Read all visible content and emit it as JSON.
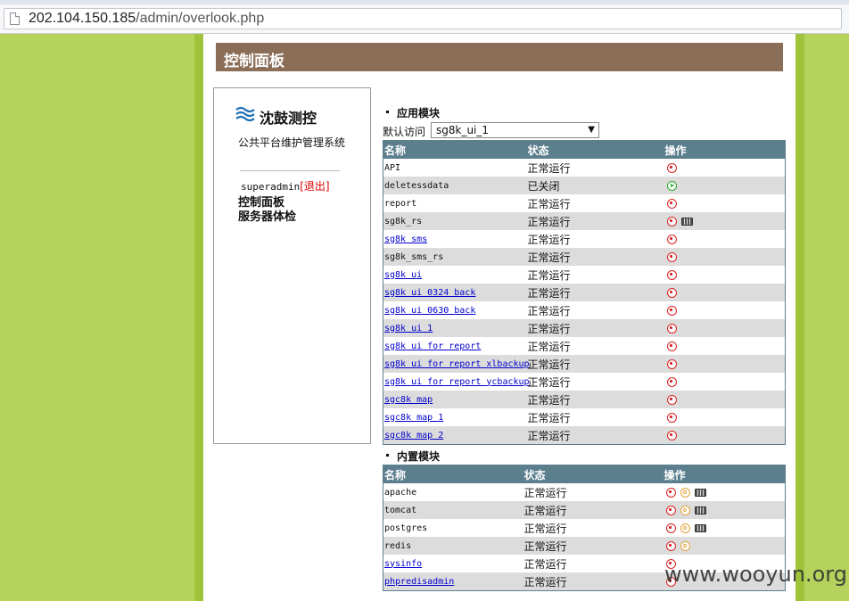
{
  "browser": {
    "url_host": "202.104.150.185",
    "url_path": "/admin/overlook.php"
  },
  "header": {
    "title": "控制面板"
  },
  "sidebar": {
    "logo_text": "沈鼓测控",
    "subtitle": "公共平台维护管理系统",
    "username": "superadmin",
    "logout_label": "[退出]",
    "nav": [
      "控制面板",
      "服务器体检"
    ]
  },
  "app_modules": {
    "section_title": "应用模块",
    "default_label": "默认访问",
    "default_value": "sg8k_ui_1",
    "columns": [
      "名称",
      "状态",
      "操作"
    ],
    "rows": [
      {
        "name": "API",
        "link": false,
        "status": "正常运行",
        "running": true,
        "ops": [
          "stop-icon"
        ]
      },
      {
        "name": "deletessdata",
        "link": false,
        "status": "已关闭",
        "running": false,
        "ops": [
          "start-icon"
        ]
      },
      {
        "name": "report",
        "link": false,
        "status": "正常运行",
        "running": true,
        "ops": [
          "stop-icon"
        ]
      },
      {
        "name": "sg8k_rs",
        "link": false,
        "status": "正常运行",
        "running": true,
        "ops": [
          "stop-icon",
          "monitor-icon"
        ]
      },
      {
        "name": "sg8k sms",
        "link": true,
        "status": "正常运行",
        "running": true,
        "ops": [
          "stop-icon"
        ]
      },
      {
        "name": "sg8k_sms_rs",
        "link": false,
        "status": "正常运行",
        "running": true,
        "ops": [
          "stop-icon"
        ]
      },
      {
        "name": "sg8k ui",
        "link": true,
        "status": "正常运行",
        "running": true,
        "ops": [
          "stop-icon"
        ]
      },
      {
        "name": "sg8k ui 0324 back",
        "link": true,
        "status": "正常运行",
        "running": true,
        "ops": [
          "stop-icon"
        ]
      },
      {
        "name": "sg8k ui 0630 back",
        "link": true,
        "status": "正常运行",
        "running": true,
        "ops": [
          "stop-icon"
        ]
      },
      {
        "name": "sg8k ui 1",
        "link": true,
        "status": "正常运行",
        "running": true,
        "ops": [
          "stop-icon"
        ]
      },
      {
        "name": "sg8k ui for report",
        "link": true,
        "status": "正常运行",
        "running": true,
        "ops": [
          "stop-icon"
        ]
      },
      {
        "name": "sg8k ui for report xlbackup",
        "link": true,
        "status": "正常运行",
        "running": true,
        "ops": [
          "stop-icon"
        ]
      },
      {
        "name": "sg8k ui for report ycbackup",
        "link": true,
        "status": "正常运行",
        "running": true,
        "ops": [
          "stop-icon"
        ]
      },
      {
        "name": "sgc8k map",
        "link": true,
        "status": "正常运行",
        "running": true,
        "ops": [
          "stop-icon"
        ]
      },
      {
        "name": "sgc8k map 1",
        "link": true,
        "status": "正常运行",
        "running": true,
        "ops": [
          "stop-icon"
        ]
      },
      {
        "name": "sgc8k map 2",
        "link": true,
        "status": "正常运行",
        "running": true,
        "ops": [
          "stop-icon"
        ]
      }
    ]
  },
  "builtin_modules": {
    "section_title": "内置模块",
    "columns": [
      "名称",
      "状态",
      "操作"
    ],
    "rows": [
      {
        "name": "apache",
        "link": false,
        "status": "正常运行",
        "running": true,
        "ops": [
          "stop-icon",
          "restart-icon",
          "monitor-icon"
        ]
      },
      {
        "name": "tomcat",
        "link": false,
        "status": "正常运行",
        "running": true,
        "ops": [
          "stop-icon",
          "restart-icon",
          "monitor-icon"
        ]
      },
      {
        "name": "postgres",
        "link": false,
        "status": "正常运行",
        "running": true,
        "ops": [
          "stop-icon",
          "restart-icon",
          "monitor-icon"
        ]
      },
      {
        "name": "redis",
        "link": false,
        "status": "正常运行",
        "running": true,
        "ops": [
          "stop-icon",
          "restart-icon"
        ]
      },
      {
        "name": "sysinfo",
        "link": true,
        "status": "正常运行",
        "running": true,
        "ops": [
          "stop-icon"
        ]
      },
      {
        "name": "phpredisadmin",
        "link": true,
        "status": "正常运行",
        "running": true,
        "ops": [
          "stop-icon"
        ]
      }
    ]
  },
  "watermark": "www.wooyun.org",
  "colors": {
    "page_bg": "#b5d35c",
    "title_bar": "#8b6e58",
    "table_header": "#5c7f8e",
    "status_running": "#1a8a1a",
    "status_closed": "#9b7a56"
  }
}
